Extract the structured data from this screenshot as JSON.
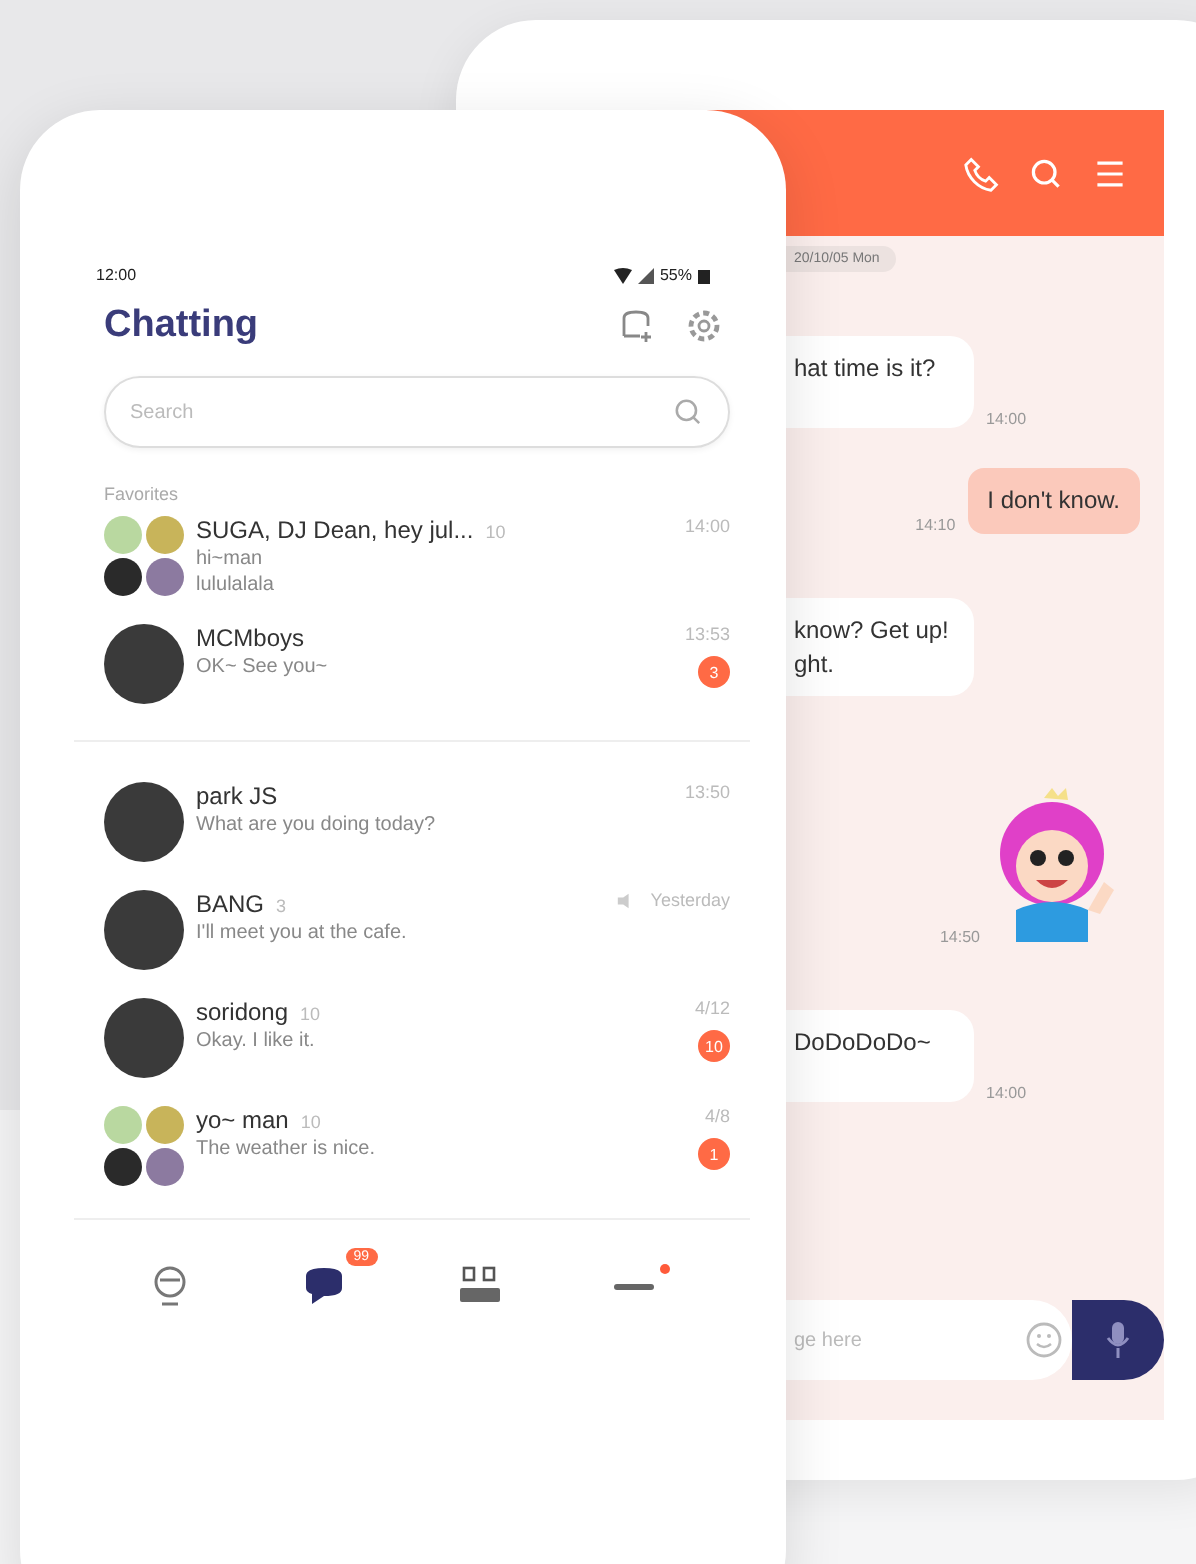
{
  "chat_room": {
    "date": "20/10/05 Mon",
    "messages": [
      {
        "kind": "received",
        "lines": [
          "hat time is it?"
        ],
        "time": "14:00"
      },
      {
        "kind": "sent",
        "lines": [
          "I don't know."
        ],
        "time": "14:10"
      },
      {
        "kind": "received",
        "lines": [
          "know? Get up!",
          "ght."
        ]
      },
      {
        "kind": "sticker",
        "time": "14:50"
      },
      {
        "kind": "received",
        "lines": [
          "DoDoDoDo~"
        ],
        "time": "14:00"
      }
    ],
    "input": {
      "placeholder": "ge here"
    }
  },
  "chat_list": {
    "status_bar": {
      "time": "12:00",
      "battery": "55%"
    },
    "title": "Chatting",
    "search": {
      "placeholder": "Search"
    },
    "section": "Favorites",
    "favorites": [
      {
        "kind": "group",
        "name": "SUGA, DJ Dean, hey jul...",
        "count": "10",
        "time": "14:00",
        "lines": [
          "hi~man",
          "lululalala"
        ],
        "muted": false
      },
      {
        "kind": "single",
        "name": "MCMboys",
        "time": "13:53",
        "lines": [
          "OK~ See you~"
        ],
        "badge": "3",
        "muted": false
      }
    ],
    "chats": [
      {
        "kind": "single",
        "name": "park JS",
        "time": "13:50",
        "lines": [
          "What are you doing today?"
        ],
        "muted": false
      },
      {
        "kind": "single",
        "name": "BANG",
        "count": "3",
        "time": "Yesterday",
        "lines": [
          "I'll meet you at the cafe."
        ],
        "muted": true
      },
      {
        "kind": "single",
        "name": "soridong",
        "count": "10",
        "time": "4/12",
        "lines": [
          "Okay. I like it."
        ],
        "badge": "10",
        "muted": false
      },
      {
        "kind": "group",
        "name": "yo~ man",
        "count": "10",
        "time": "4/8",
        "lines": [
          "The weather is nice."
        ],
        "badge": "1",
        "muted": false
      }
    ],
    "nav": [
      {
        "kind": "friends",
        "selected": false,
        "dot": false
      },
      {
        "kind": "chats",
        "selected": true,
        "badge": "99",
        "dot": false
      },
      {
        "kind": "menu",
        "selected": false,
        "dot": false
      },
      {
        "kind": "more",
        "selected": false,
        "dot": true
      }
    ]
  }
}
